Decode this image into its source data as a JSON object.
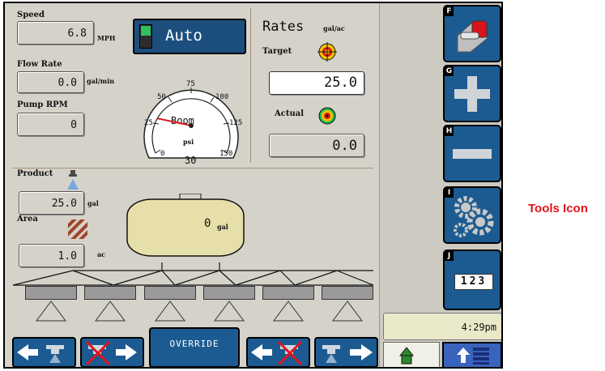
{
  "speed": {
    "label": "Speed",
    "value": "6.8",
    "unit": "MPH"
  },
  "mode": {
    "label": "Auto"
  },
  "flow_rate": {
    "label": "Flow Rate",
    "value": "0.0",
    "unit": "gal/min"
  },
  "pump_rpm": {
    "label": "Pump RPM",
    "value": "0"
  },
  "gauge": {
    "label": "Boom",
    "unit": "psi",
    "ticks": [
      "0",
      "25",
      "50",
      "75",
      "100",
      "125",
      "150"
    ],
    "bottom_value": "30",
    "needle_value": 30
  },
  "rates": {
    "title": "Rates",
    "unit": "gal/ac",
    "target_label": "Target",
    "target_value": "25.0",
    "actual_label": "Actual",
    "actual_value": "0.0"
  },
  "product": {
    "label": "Product",
    "value": "25.0",
    "unit": "gal"
  },
  "area": {
    "label": "Area",
    "value": "1.0",
    "unit": "ac"
  },
  "tank": {
    "value": "0",
    "unit": "gal"
  },
  "override": {
    "label": "OVERRIDE"
  },
  "sidebar": {
    "buttons": [
      {
        "key": "F",
        "icon": "master-switch-icon"
      },
      {
        "key": "G",
        "icon": "plus-icon"
      },
      {
        "key": "H",
        "icon": "minus-icon"
      },
      {
        "key": "I",
        "icon": "gears-icon"
      },
      {
        "key": "J",
        "icon": "keypad-icon",
        "text": "123"
      }
    ]
  },
  "time": "4:29pm",
  "callout": "Tools Icon",
  "colors": {
    "button_blue": "#1c5b91",
    "panel_bg": "#d5d3c9",
    "tank_fill": "#e6dfa9",
    "callout_red": "#e3151a"
  }
}
